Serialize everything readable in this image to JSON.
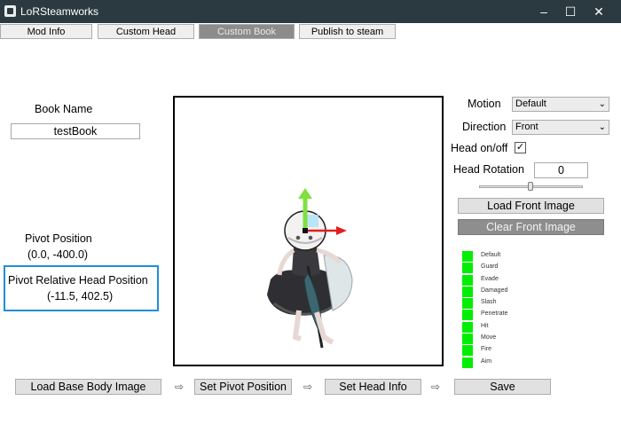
{
  "window": {
    "title": "LoRSteamworks",
    "minimize": "–",
    "maximize": "☐",
    "close": "✕"
  },
  "tabs": [
    {
      "label": "Mod Info",
      "active": false
    },
    {
      "label": "Custom Head",
      "active": false
    },
    {
      "label": "Custom Book",
      "active": true
    },
    {
      "label": "Publish to steam",
      "active": false
    }
  ],
  "left": {
    "book_name_label": "Book Name",
    "book_name_value": "testBook",
    "pivot_label": "Pivot Position",
    "pivot_value": "(0.0, -400.0)",
    "rel_head_label": "Pivot Relative Head Position",
    "rel_head_value": "(-11.5, 402.5)"
  },
  "right": {
    "motion_label": "Motion",
    "motion_value": "Default",
    "direction_label": "Direction",
    "direction_value": "Front",
    "head_onoff_label": "Head on/off",
    "head_onoff_checked": "✓",
    "head_rotation_label": "Head Rotation",
    "head_rotation_value": "0",
    "head_rotation_level": 0.5,
    "load_front_label": "Load Front Image",
    "clear_front_label": "Clear Front Image",
    "motions": [
      "Default",
      "Guard",
      "Evade",
      "Damaged",
      "Slash",
      "Penetrate",
      "Hit",
      "Move",
      "Fire",
      "Aim"
    ],
    "motion_color": "#00ee00"
  },
  "bottom": {
    "load_base_label": "Load Base Body Image",
    "set_pivot_label": "Set Pivot Position",
    "set_head_label": "Set Head Info",
    "save_label": "Save",
    "step_arrow": "⇨"
  },
  "colors": {
    "titlebar": "#2b3a40",
    "highlight": "#1e8fd8",
    "gizmo_x": "#e02020",
    "gizmo_y": "#7fe040"
  }
}
